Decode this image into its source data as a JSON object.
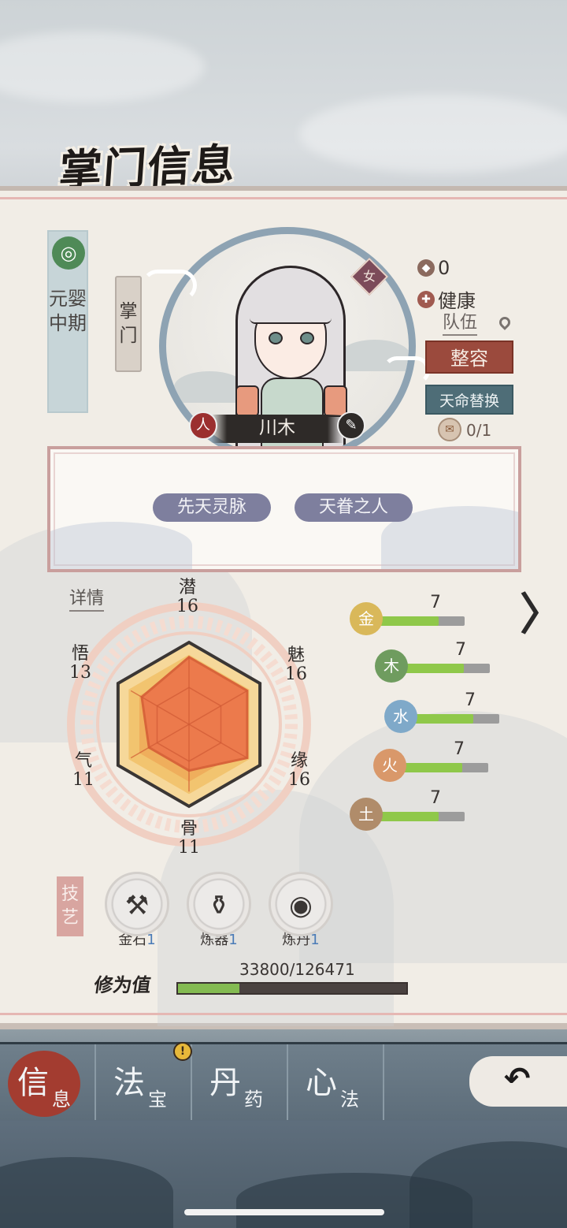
{
  "page_title": "掌门信息",
  "rank": {
    "icon": "spiral-icon",
    "text": "元婴中期"
  },
  "role": "掌门",
  "character": {
    "name": "川木",
    "gender": "女",
    "left_icon_char": "人",
    "right_icon": "brush-icon"
  },
  "status": {
    "coin_value": "0",
    "health": "健康",
    "team_label": "队伍"
  },
  "buttons": {
    "makeover": "整容",
    "fate_swap": "天命替换"
  },
  "fate_item_count": "0/1",
  "traits": [
    "先天灵脉",
    "天眷之人"
  ],
  "detail_link": "详情",
  "attributes": [
    {
      "name": "潜",
      "value": "16"
    },
    {
      "name": "魅",
      "value": "16"
    },
    {
      "name": "缘",
      "value": "16"
    },
    {
      "name": "骨",
      "value": "11"
    },
    {
      "name": "气",
      "value": "11"
    },
    {
      "name": "悟",
      "value": "13"
    }
  ],
  "elements": [
    {
      "glyph": "金",
      "value": "7",
      "color": "#d9b85a"
    },
    {
      "glyph": "木",
      "value": "7",
      "color": "#6f9c5f"
    },
    {
      "glyph": "水",
      "value": "7",
      "color": "#7fa9c9"
    },
    {
      "glyph": "火",
      "value": "7",
      "color": "#d9986a"
    },
    {
      "glyph": "土",
      "value": "7",
      "color": "#b08c6a"
    }
  ],
  "skills_tag": "技艺",
  "skills": [
    {
      "name": "金石",
      "level": "1",
      "icon": "hammer-icon"
    },
    {
      "name": "炼器",
      "level": "1",
      "icon": "cauldron-icon"
    },
    {
      "name": "炼丹",
      "level": "1",
      "icon": "pill-icon"
    }
  ],
  "cultivation": {
    "label": "修为值",
    "text": "33800/126471",
    "current": 33800,
    "max": 126471
  },
  "nav": [
    {
      "main": "信",
      "sub": "息",
      "active": true
    },
    {
      "main": "法",
      "sub": "宝",
      "active": false
    },
    {
      "main": "丹",
      "sub": "药",
      "active": false
    },
    {
      "main": "心",
      "sub": "法",
      "active": false
    }
  ],
  "alert_badge": "!",
  "back_icon": "back-arrow-icon"
}
